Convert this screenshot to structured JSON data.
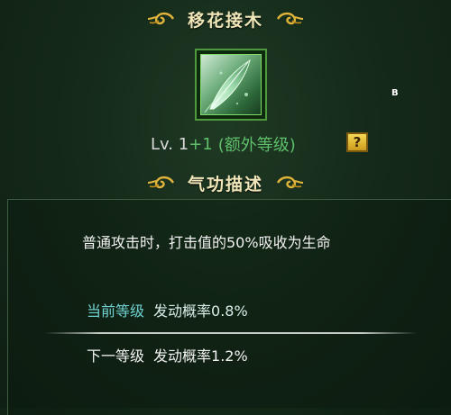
{
  "skill": {
    "name": "移花接木",
    "icon": "leaf-blade-skill-icon",
    "level_prefix": "Lv. 1",
    "level_bonus": "+1",
    "level_extra_label": "(额外等级)"
  },
  "help_button": {
    "label": "?"
  },
  "marker": {
    "label": "B"
  },
  "description": {
    "header": "气功描述",
    "text": "普通攻击时，打击值的50%吸收为生命"
  },
  "current_level": {
    "label": "当前等级",
    "value": "发动概率0.8%"
  },
  "next_level": {
    "label": "下一等级",
    "value": "发动概率1.2%"
  },
  "colors": {
    "title": "#f0e6b8",
    "accent_green": "#5fbf6a",
    "current_cyan": "#6fd1d0",
    "help_gold": "#f8d955"
  }
}
